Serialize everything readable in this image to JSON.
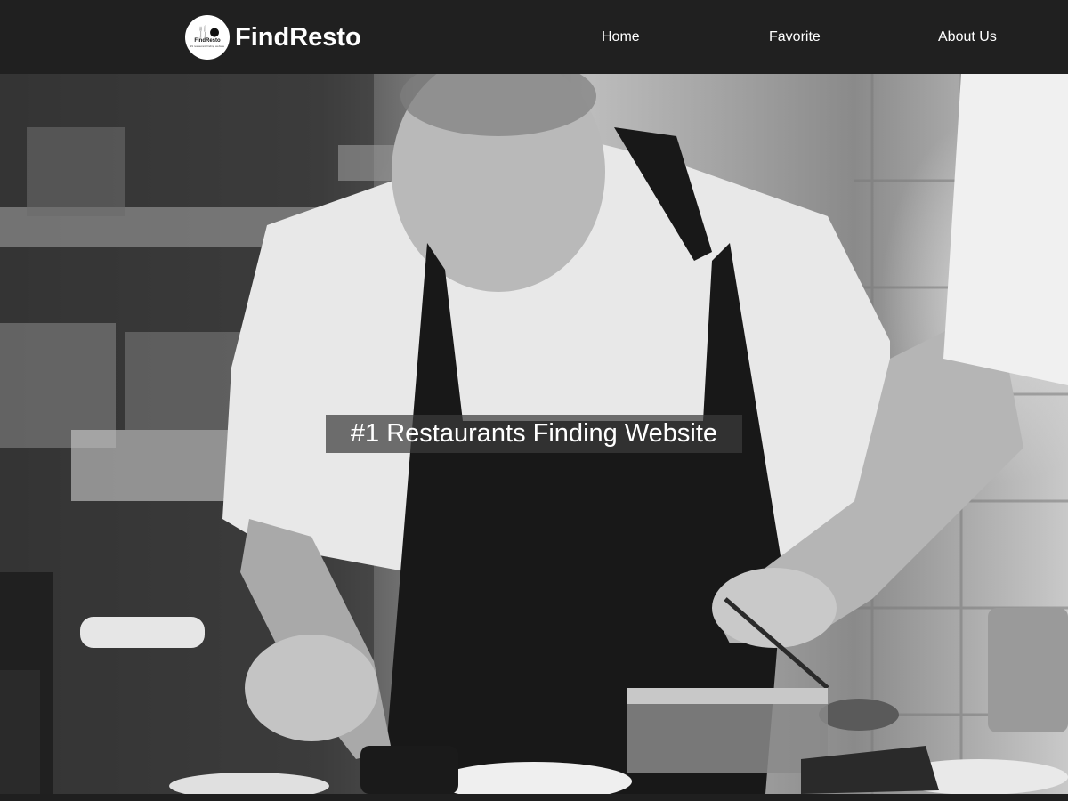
{
  "header": {
    "brand_name": "FindResto",
    "logo": {
      "icon": "plate-and-cutlery-icon",
      "text": "FindResto",
      "tagline": "#1 restaurant finding website"
    },
    "nav": [
      {
        "label": "Home"
      },
      {
        "label": "Favorite"
      },
      {
        "label": "About Us"
      }
    ]
  },
  "hero": {
    "image": "grayscale-chef-plating-food-photo",
    "tagline": "#1 Restaurants Finding Website"
  },
  "colors": {
    "navbar_bg": "#202020",
    "text": "#ffffff",
    "tagline_bg": "rgba(60,60,60,0.72)"
  }
}
